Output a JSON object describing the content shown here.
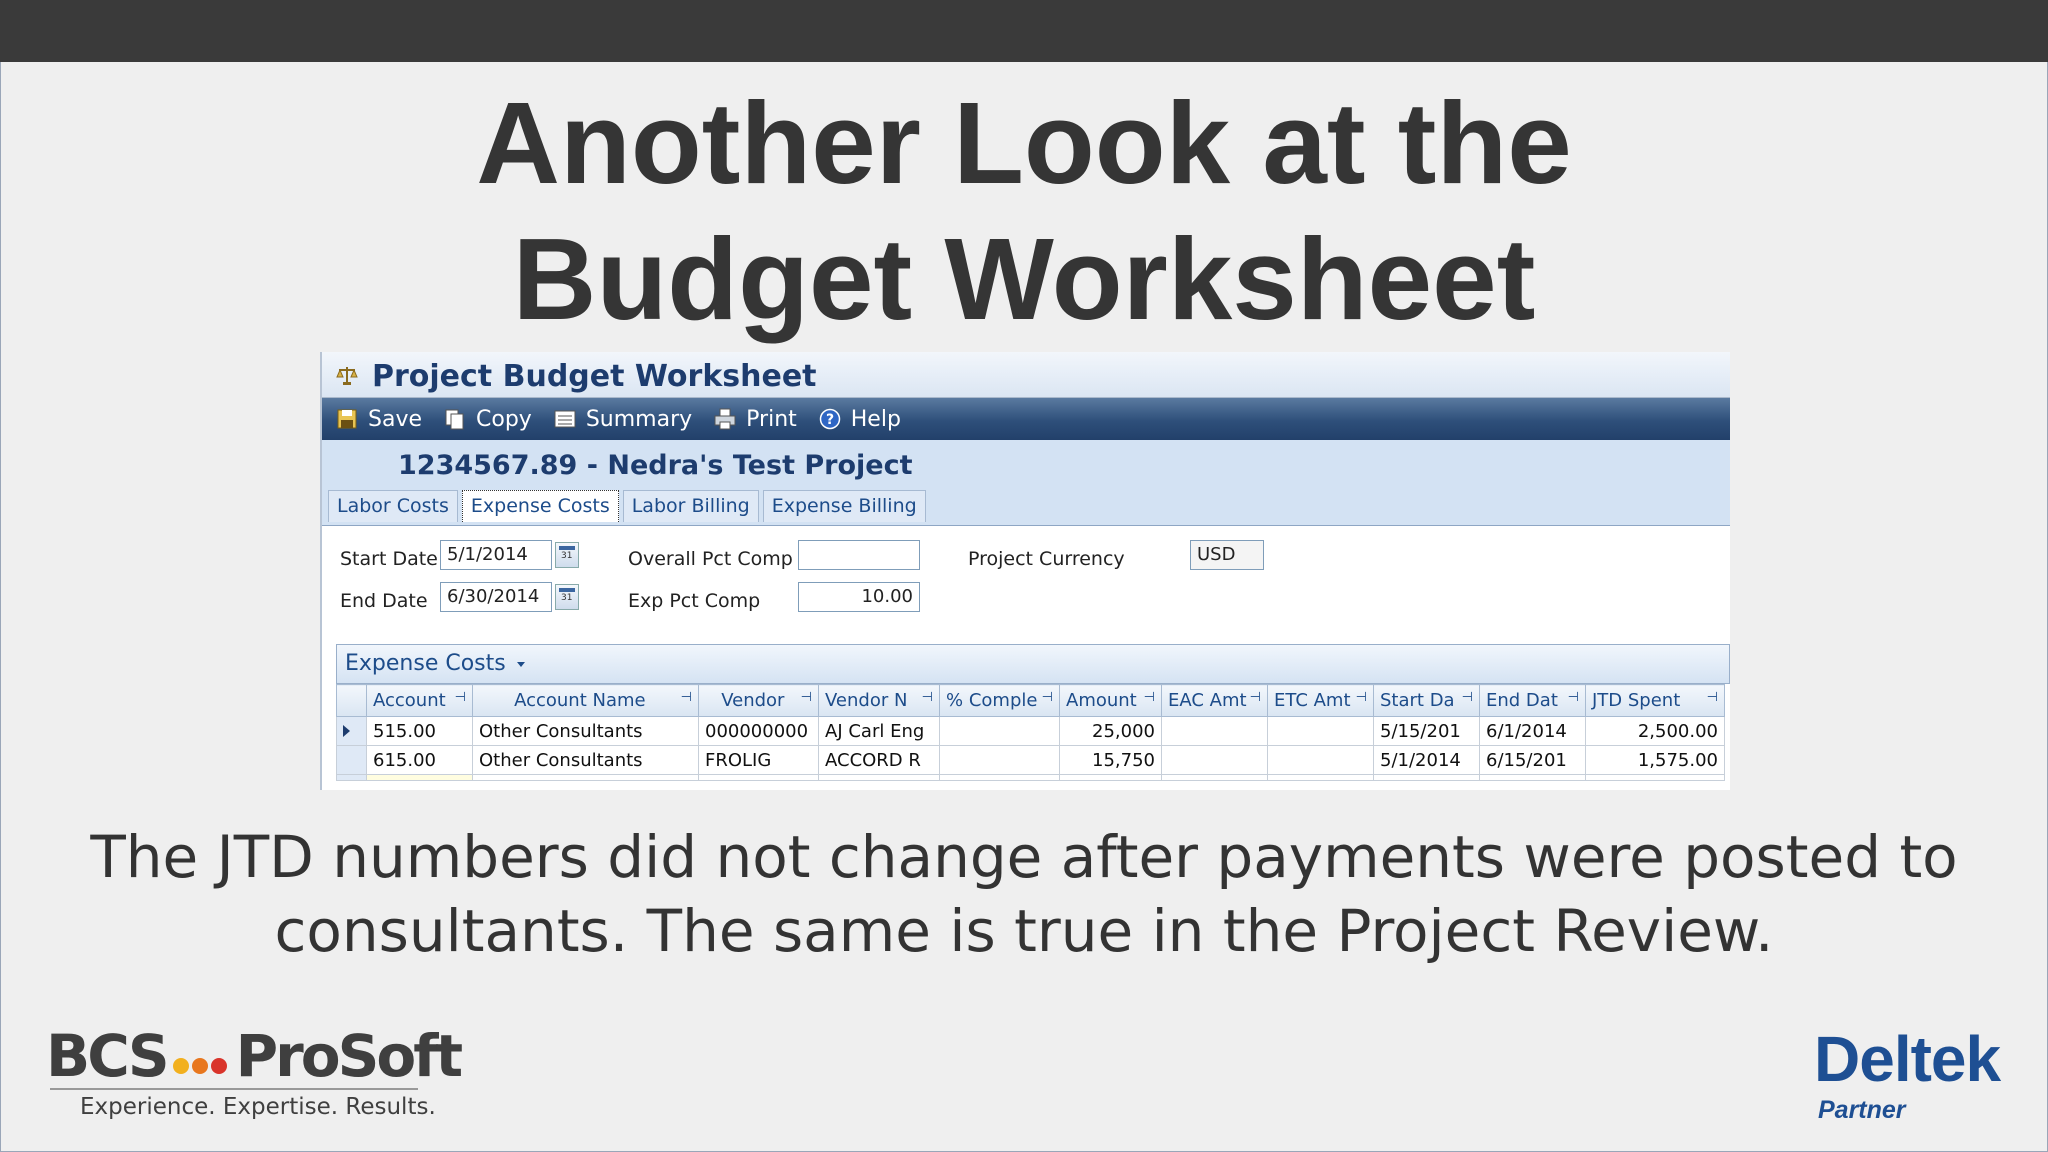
{
  "slide": {
    "title_line1": "Another Look at the",
    "title_line2": "Budget Worksheet",
    "caption_line1": "The JTD numbers did not change after payments were posted to",
    "caption_line2": "consultants. The same is true in the Project Review."
  },
  "window": {
    "title": "Project Budget Worksheet",
    "toolbar": [
      {
        "label": "Save",
        "icon": "save-icon"
      },
      {
        "label": "Copy",
        "icon": "copy-icon"
      },
      {
        "label": "Summary",
        "icon": "summary-icon"
      },
      {
        "label": "Print",
        "icon": "print-icon"
      },
      {
        "label": "Help",
        "icon": "help-icon"
      }
    ],
    "project_title": "1234567.89 - Nedra's Test Project",
    "tabs": [
      "Labor Costs",
      "Expense Costs",
      "Labor Billing",
      "Expense Billing"
    ],
    "active_tab": "Expense Costs"
  },
  "form": {
    "start_date_label": "Start Date",
    "start_date_value": "5/1/2014",
    "end_date_label": "End Date",
    "end_date_value": "6/30/2014",
    "overall_pct_label": "Overall Pct Comp",
    "overall_pct_value": "",
    "exp_pct_label": "Exp Pct Comp",
    "exp_pct_value": "10.00",
    "currency_label": "Project Currency",
    "currency_value": "USD"
  },
  "grid": {
    "title": "Expense Costs",
    "columns": [
      "Account",
      "Account Name",
      "Vendor",
      "Vendor N",
      "% Comple",
      "Amount",
      "EAC Amt",
      "ETC Amt",
      "Start Da",
      "End Dat",
      "JTD Spent"
    ],
    "rows": [
      [
        "515.00",
        "Other Consultants",
        "000000000",
        "AJ Carl Eng",
        "",
        "25,000",
        "",
        "",
        "5/15/201",
        "6/1/2014",
        "2,500.00"
      ],
      [
        "615.00",
        "Other Consultants",
        "FROLIG",
        "ACCORD R",
        "",
        "15,750",
        "",
        "",
        "5/1/2014",
        "6/15/201",
        "1,575.00"
      ]
    ]
  },
  "logos": {
    "bcs_left": "BCS",
    "bcs_right": "ProSoft",
    "bcs_tagline": "Experience. Expertise. Results.",
    "bcs_dot_colors": [
      "#f2b01e",
      "#e8771e",
      "#d9342b"
    ],
    "deltek": "Deltek",
    "deltek_partner": "Partner"
  }
}
